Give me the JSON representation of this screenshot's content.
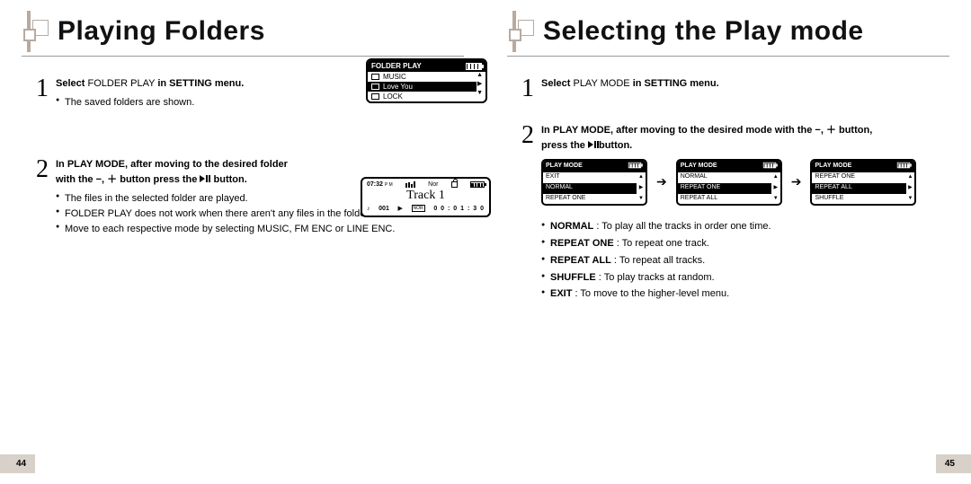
{
  "left": {
    "title": "Playing Folders",
    "pagenum": "44",
    "step1": {
      "lead_bold": "Select",
      "lead_rest": " FOLDER PLAY ",
      "lead_tail": "in SETTING menu.",
      "bullets": [
        "The saved folders are shown."
      ]
    },
    "step2": {
      "lead_a": "In PLAY MODE, after moving to the desired folder",
      "lead_b_pre": "with the ",
      "lead_b_mid": " button press the ",
      "lead_b_post": " button.",
      "bullets": [
        "The files in the selected folder are played.",
        "FOLDER PLAY does not work when there aren't any files in the folder.",
        "Move to each respective mode by selecting MUSIC, FM ENC or LINE ENC."
      ]
    },
    "folder_lcd": {
      "title": "FOLDER PLAY",
      "rows": [
        "MUSIC",
        "Love You",
        "LOCK"
      ],
      "selected_index": 1
    },
    "track_lcd": {
      "time": "07:32",
      "ampm": "P M",
      "eq": "Nor",
      "track": "Track 1",
      "idx": "001",
      "mode": "NOR",
      "elapsed": "0 0 : 0 1 : 3 0"
    }
  },
  "right": {
    "title": "Selecting the Play mode",
    "pagenum": "45",
    "step1": {
      "lead_bold": "Select",
      "lead_rest": " PLAY MODE ",
      "lead_tail": "in SETTING menu."
    },
    "step2": {
      "lead_a_pre": "In PLAY MODE, after moving to the desired mode with the ",
      "lead_a_post": " button,",
      "lead_b_pre": "press the ",
      "lead_b_post": "button."
    },
    "pm_lcds": [
      {
        "title": "PLAY MODE",
        "rows": [
          "EXIT",
          "NORMAL",
          "REPEAT ONE"
        ],
        "sel": 1
      },
      {
        "title": "PLAY MODE",
        "rows": [
          "NORMAL",
          "REPEAT ONE",
          "REPEAT ALL"
        ],
        "sel": 1
      },
      {
        "title": "PLAY MODE",
        "rows": [
          "REPEAT ONE",
          "REPEAT ALL",
          "SHUFFLE"
        ],
        "sel": 1
      }
    ],
    "descs": [
      {
        "t": "NORMAL",
        "d": " : To play all the tracks in order one time."
      },
      {
        "t": "REPEAT ONE",
        "d": " : To repeat one track."
      },
      {
        "t": "REPEAT ALL",
        "d": " : To repeat all tracks."
      },
      {
        "t": "SHUFFLE",
        "d": " : To play tracks at random."
      },
      {
        "t": "EXIT",
        "d": " : To move to the higher-level menu."
      }
    ]
  }
}
